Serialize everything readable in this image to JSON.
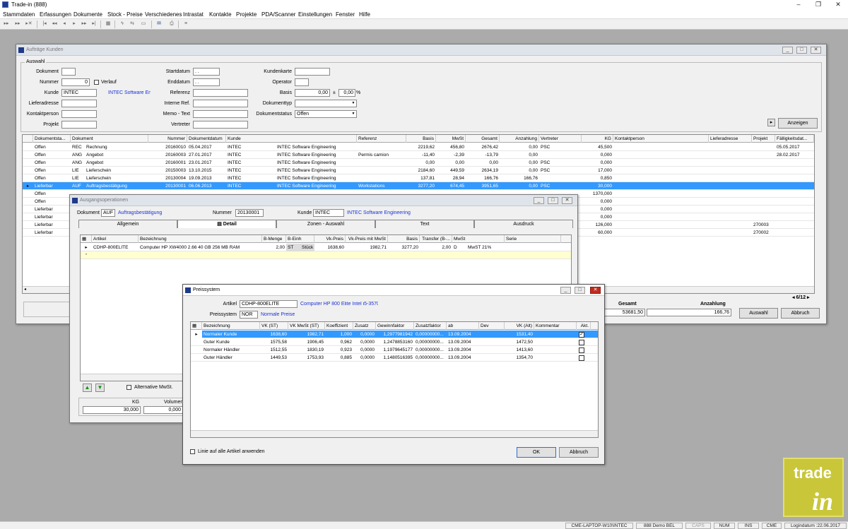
{
  "app": {
    "title": "Trade-in (888)"
  },
  "menu": [
    "Stammdaten",
    "Erfassungen",
    "Dokumente",
    "Stock - Preise",
    "Verschiedenes",
    "Intrastat",
    "Kontakte",
    "Projekte",
    "PDA/Scanner",
    "Einstellungen",
    "Fenster",
    "Hilfe"
  ],
  "auftraege": {
    "title": "Aufträge Kunden",
    "group": "Auswahl",
    "labels": {
      "dokument": "Dokument",
      "nummer": "Nummer",
      "verlauf": "Verlauf",
      "kunde": "Kunde",
      "lieferadresse": "Lieferadresse",
      "kontaktperson": "Kontaktperson",
      "projekt": "Projekt",
      "startdatum": "Startdatum",
      "enddatum": "Enddatum",
      "referenz": "Referenz",
      "interne_ref": "Interne Ref.",
      "memo_text": "Memo - Text",
      "vertreter": "Vertreter",
      "kundenkarte": "Kundenkarte",
      "operator": "Operator",
      "basis": "Basis",
      "dokumenttyp": "Dokumenttyp",
      "dokumentstatus": "Dokumentstatus"
    },
    "values": {
      "nummer": "0",
      "kunde": "INTEC",
      "kunde_name": "INTEC Software Engineering",
      "startdatum": ". .",
      "enddatum": ". .",
      "basis": "0,00",
      "basis_pm": "±",
      "basis_pct": "0,00",
      "pct": "%",
      "dokumentstatus": "Offen"
    },
    "anzeigen": "Anzeigen",
    "columns": [
      "Dokumentsta...",
      "Dokument",
      "",
      "Nummer",
      "Dokumentdatum",
      "Kunde",
      "",
      "Referenz",
      "Basis",
      "MwSt",
      "Gesamt",
      "Anzahlung",
      "Vertreter",
      "KG",
      "Kontaktperson",
      "Lieferadresse",
      "Projekt",
      "Fälligkeitsdat..."
    ],
    "rows": [
      {
        "status": "Offen",
        "doc": "REC",
        "docname": "Rechnung",
        "nummer": "20160010",
        "datum": "05.04.2017",
        "kunde": "INTEC",
        "kundename": "INTEC Software Engineering",
        "referenz": "",
        "basis": "2219,62",
        "mwst": "456,80",
        "gesamt": "2676,42",
        "anzahlung": "0,00",
        "vertreter": "PSC",
        "kg": "45,500",
        "projekt": "",
        "faellig": "05.05.2017"
      },
      {
        "status": "Offen",
        "doc": "ANG",
        "docname": "Angebot",
        "nummer": "20160003",
        "datum": "27.01.2017",
        "kunde": "INTEC",
        "kundename": "INTEC Software Engineering",
        "referenz": "Permis camion",
        "basis": "-11,40",
        "mwst": "-2,39",
        "gesamt": "-13,79",
        "anzahlung": "0,00",
        "vertreter": "",
        "kg": "0,000",
        "projekt": "",
        "faellig": "28.02.2017"
      },
      {
        "status": "Offen",
        "doc": "ANG",
        "docname": "Angebot",
        "nummer": "20160001",
        "datum": "23.01.2017",
        "kunde": "INTEC",
        "kundename": "INTEC Software Engineering",
        "referenz": "",
        "basis": "0,00",
        "mwst": "0,00",
        "gesamt": "0,00",
        "anzahlung": "0,00",
        "vertreter": "PSC",
        "kg": "0,000",
        "projekt": "",
        "faellig": ""
      },
      {
        "status": "Offen",
        "doc": "LIE",
        "docname": "Lieferschein",
        "nummer": "20150003",
        "datum": "13.10.2015",
        "kunde": "INTEC",
        "kundename": "INTEC Software Engineering",
        "referenz": "",
        "basis": "2184,60",
        "mwst": "449,59",
        "gesamt": "2634,19",
        "anzahlung": "0,00",
        "vertreter": "PSC",
        "kg": "17,000",
        "projekt": "",
        "faellig": ""
      },
      {
        "status": "Offen",
        "doc": "LIE",
        "docname": "Lieferschein",
        "nummer": "20130004",
        "datum": "19.09.2013",
        "kunde": "INTEC",
        "kundename": "INTEC Software Engineering",
        "referenz": "",
        "basis": "137,81",
        "mwst": "28,94",
        "gesamt": "166,76",
        "anzahlung": "166,76",
        "vertreter": "",
        "kg": "0,850",
        "projekt": "",
        "faellig": ""
      },
      {
        "status": "Lieferbar",
        "doc": "AUF",
        "docname": "Auftragsbestätigung",
        "nummer": "20130001",
        "datum": "06.06.2013",
        "kunde": "INTEC",
        "kundename": "INTEC Software Engineering",
        "referenz": "Workstations",
        "basis": "3277,20",
        "mwst": "674,45",
        "gesamt": "3951,65",
        "anzahlung": "0,00",
        "vertreter": "PSC",
        "kg": "30,000",
        "projekt": "",
        "faellig": ""
      },
      {
        "status": "Offen",
        "kg": "1370,000",
        "projekt": ""
      },
      {
        "status": "Offen",
        "kg": "0,000",
        "projekt": ""
      },
      {
        "status": "Lieferbar",
        "kg": "0,000",
        "projekt": ""
      },
      {
        "status": "Lieferbar",
        "kg": "0,000",
        "projekt": ""
      },
      {
        "status": "Lieferbar",
        "kg": "126,000",
        "projekt": "270003"
      },
      {
        "status": "Lieferbar",
        "kg": "60,000",
        "projekt": "270002"
      }
    ],
    "pager": "6/12",
    "gesamt_label": "Gesamt",
    "gesamt": "53681,50",
    "anzahlung_label": "Anzahlung",
    "anzahlung": "166,76",
    "auswahl": "Auswahl",
    "abbruch": "Abbruch"
  },
  "ausgang": {
    "title": "Ausgangsoperationen",
    "dokument_label": "Dokument",
    "dokument": "AUF",
    "dokument_name": "Auftragsbestätigung",
    "nummer_label": "Nummer",
    "nummer": "20130001",
    "kunde_label": "Kunde",
    "kunde": "INTEC",
    "kunde_name": "INTEC Software Engineering",
    "tabs": [
      "Allgemein",
      "Detail",
      "Zonen - Auswahl",
      "Text",
      "Ausdruck"
    ],
    "columns": [
      "Artikel",
      "Bezeichnung",
      "B-Menge",
      "B-Einh",
      "Vk-Preis",
      "Vk-Preis mit MwSt",
      "Basis",
      "Transfer (B-...",
      "MwSt",
      "Serie"
    ],
    "row": {
      "artikel": "CDHP-800ELITE",
      "bez": "Computer HP XW4000 2.66 40 GB 256 MB RAM",
      "menge": "2,00",
      "einh": "ST",
      "einh2": "Stück",
      "preis": "1638,60",
      "preismwst": "1982,71",
      "basis": "3277,20",
      "transfer": "2,00",
      "mwst": "D",
      "mwst2": "MwST 21%"
    },
    "alt_mwst": "Alternative MwSt.",
    "kg_label": "KG",
    "kg": "30,000",
    "vol_label": "Volumen",
    "vol": "0,000"
  },
  "preis": {
    "title": "Preissystem",
    "artikel_label": "Artikel",
    "artikel": "CDHP-800ELITE",
    "artikel_name": "Computer HP 800 Elite Intel i5-3570 3",
    "system_label": "Preissystem",
    "system": "NOR",
    "system_name": "Normale Preise",
    "columns": [
      "Bezeichnung",
      "VK (ST)",
      "VK MwSt (ST)",
      "Koeffizient",
      "Zusatz",
      "Gewinnfaktor",
      "Zusatzfaktor",
      "ab",
      "Dev",
      "VK (Alt)",
      "Kommentar",
      "Akt."
    ],
    "rows": [
      {
        "bez": "Normaler Kunde",
        "vk": "1638,60",
        "vkm": "1982,71",
        "koef": "1,000",
        "zus": "0,0000",
        "gew": "1,2977981942",
        "zf": "0,00000000...",
        "ab": "13.09.2004",
        "dev": "",
        "alt": "1531,40",
        "akt": true
      },
      {
        "bez": "Guter Kunde",
        "vk": "1575,58",
        "vkm": "1906,45",
        "koef": "0,962",
        "zus": "0,0000",
        "gew": "1,2478853160",
        "zf": "0,00000000...",
        "ab": "13.09.2004",
        "dev": "",
        "alt": "1472,50",
        "akt": false
      },
      {
        "bez": "Normaler Händler",
        "vk": "1512,55",
        "vkm": "1830,19",
        "koef": "0,923",
        "zus": "0,0000",
        "gew": "1,1979645177",
        "zf": "0,00000000...",
        "ab": "13.09.2004",
        "dev": "",
        "alt": "1413,60",
        "akt": false
      },
      {
        "bez": "Guter Händler",
        "vk": "1449,53",
        "vkm": "1753,93",
        "koef": "0,885",
        "zus": "0,0000",
        "gew": "1,1480516395",
        "zf": "0,00000000...",
        "ab": "13.09.2004",
        "dev": "",
        "alt": "1354,70",
        "akt": false
      }
    ],
    "linie": "Linie auf alle Artikel anwenden",
    "ok": "OK",
    "abbruch": "Abbruch"
  },
  "status": {
    "machine": "CME-LAPTOP-W10\\INTEC",
    "db": "888 Demo BEL",
    "caps": "CAPS",
    "num": "NUM",
    "ins": "INS",
    "user": "CME",
    "login": "Logindatum :22.06.2017"
  },
  "logo": {
    "text1": "trade",
    "text2": "in"
  }
}
